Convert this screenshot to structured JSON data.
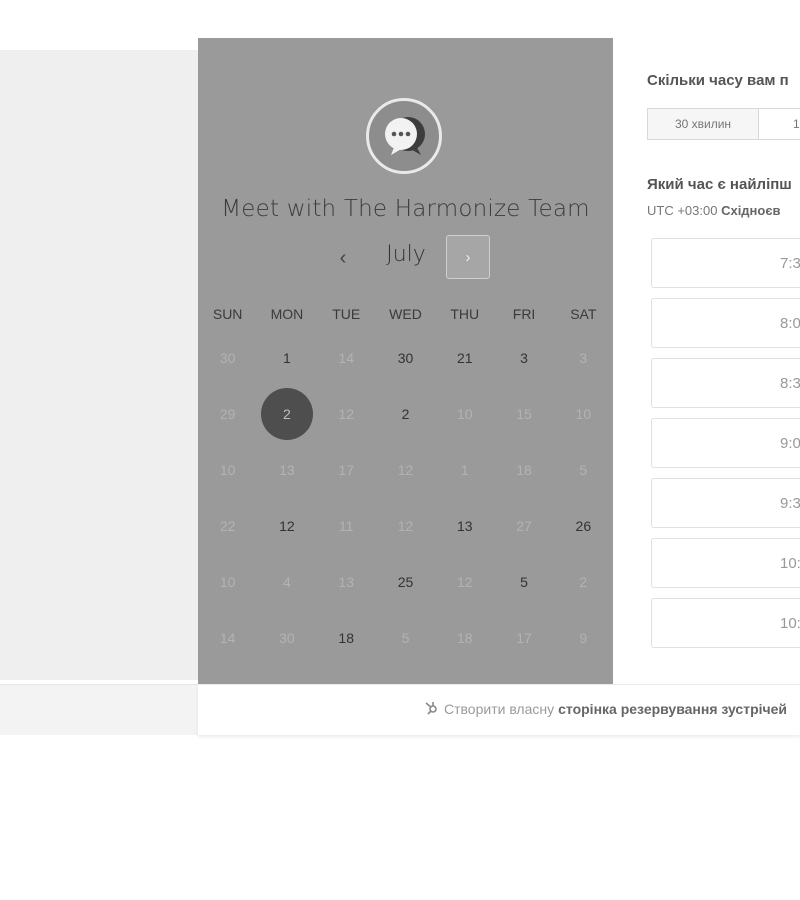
{
  "calendar": {
    "title": "Meet with The Harmonize Team",
    "month": "July",
    "prev_icon": "‹",
    "next_icon": "›",
    "weekdays": [
      "SUN",
      "MON",
      "TUE",
      "WED",
      "THU",
      "FRI",
      "SAT"
    ],
    "weeks": [
      [
        {
          "d": "30",
          "s": "muted"
        },
        {
          "d": "1",
          "s": "dark"
        },
        {
          "d": "14",
          "s": "muted"
        },
        {
          "d": "30",
          "s": "dark"
        },
        {
          "d": "21",
          "s": "dark"
        },
        {
          "d": "3",
          "s": "dark"
        },
        {
          "d": "3",
          "s": "muted"
        }
      ],
      [
        {
          "d": "29",
          "s": "muted"
        },
        {
          "d": "2",
          "s": "selected"
        },
        {
          "d": "12",
          "s": "muted"
        },
        {
          "d": "2",
          "s": "dark"
        },
        {
          "d": "10",
          "s": "muted"
        },
        {
          "d": "15",
          "s": "muted"
        },
        {
          "d": "10",
          "s": "muted"
        }
      ],
      [
        {
          "d": "10",
          "s": "muted"
        },
        {
          "d": "13",
          "s": "muted"
        },
        {
          "d": "17",
          "s": "muted"
        },
        {
          "d": "12",
          "s": "muted"
        },
        {
          "d": "1",
          "s": "muted"
        },
        {
          "d": "18",
          "s": "muted"
        },
        {
          "d": "5",
          "s": "muted"
        }
      ],
      [
        {
          "d": "22",
          "s": "muted"
        },
        {
          "d": "12",
          "s": "dark"
        },
        {
          "d": "11",
          "s": "muted"
        },
        {
          "d": "12",
          "s": "muted"
        },
        {
          "d": "13",
          "s": "dark"
        },
        {
          "d": "27",
          "s": "muted"
        },
        {
          "d": "26",
          "s": "dark"
        }
      ],
      [
        {
          "d": "10",
          "s": "muted"
        },
        {
          "d": "4",
          "s": "muted"
        },
        {
          "d": "13",
          "s": "muted"
        },
        {
          "d": "25",
          "s": "dark"
        },
        {
          "d": "12",
          "s": "muted"
        },
        {
          "d": "5",
          "s": "dark"
        },
        {
          "d": "2",
          "s": "muted"
        }
      ],
      [
        {
          "d": "14",
          "s": "muted"
        },
        {
          "d": "30",
          "s": "muted"
        },
        {
          "d": "18",
          "s": "dark"
        },
        {
          "d": "5",
          "s": "muted"
        },
        {
          "d": "18",
          "s": "muted"
        },
        {
          "d": "17",
          "s": "muted"
        },
        {
          "d": "9",
          "s": "muted"
        }
      ]
    ]
  },
  "booking": {
    "duration_question": "Скільки часу вам п",
    "durations": [
      "30 хвилин",
      "1"
    ],
    "time_question": "Який час є найліпш",
    "tz_prefix": "UTC +03:00",
    "tz_name": "Східноєв",
    "slots": [
      "7:3",
      "8:0",
      "8:3",
      "9:0",
      "9:3",
      "10:",
      "10:"
    ]
  },
  "footer": {
    "icon": "hubspot-sprocket-icon",
    "text": "Створити власну",
    "bold": "сторінка резервування зустрічей"
  }
}
